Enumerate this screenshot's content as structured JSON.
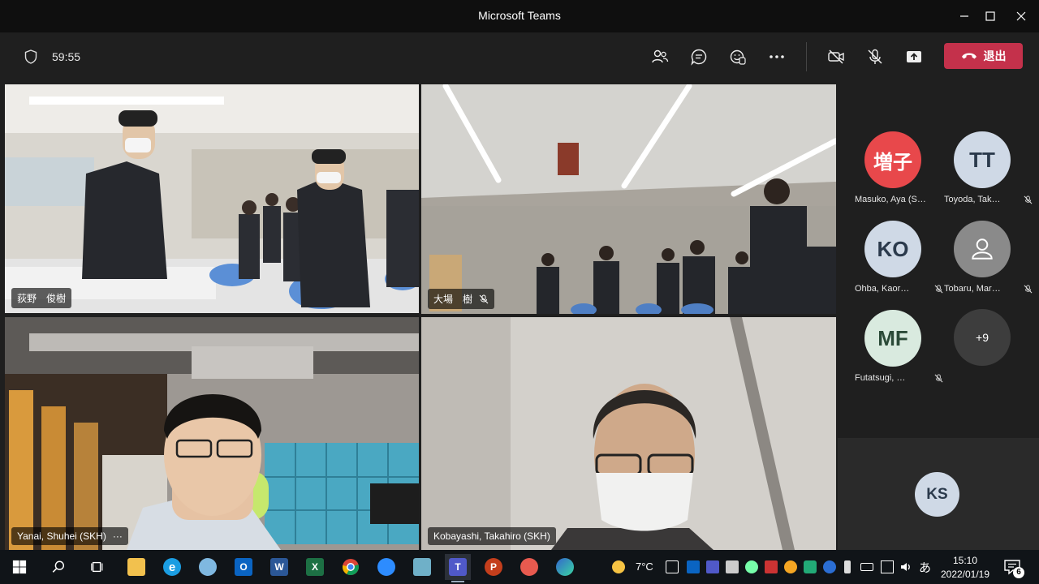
{
  "window": {
    "title": "Microsoft Teams"
  },
  "toolbar": {
    "timer": "59:55",
    "leave_label": "退出",
    "icons": [
      "people-icon",
      "chat-icon",
      "reactions-icon",
      "more-icon",
      "camera-off-icon",
      "mic-off-icon",
      "share-icon"
    ]
  },
  "video_tiles": [
    {
      "name": "荻野　俊樹",
      "active": true,
      "muted": false
    },
    {
      "name": "大場　樹",
      "active": false,
      "muted": true
    },
    {
      "name": "Yanai, Shuhei (SKH)",
      "active": false,
      "muted": false,
      "more": "···"
    },
    {
      "name": "Kobayashi, Takahiro (SKH)",
      "active": false,
      "muted": false
    }
  ],
  "roster": [
    {
      "initials": "増子",
      "name": "Masuko, Aya (S…",
      "color": "#e8484b",
      "text_color": "#ffffff",
      "muted": false
    },
    {
      "initials": "TT",
      "name": "Toyoda, Tak…",
      "color": "#cfd9e6",
      "text_color": "#2b3a4c",
      "muted": true
    },
    {
      "initials": "KO",
      "name": "Ohba, Kaor…",
      "color": "#cfd9e6",
      "text_color": "#2b3a4c",
      "muted": true
    },
    {
      "initials": "",
      "name": "Tobaru, Mar…",
      "color": "#8a8a8a",
      "text_color": "#ffffff",
      "muted": true,
      "icon": "person-icon"
    },
    {
      "initials": "MF",
      "name": "Futatsugi, …",
      "color": "#d9eadf",
      "text_color": "#2b4a38",
      "muted": true
    }
  ],
  "roster_more": "+9",
  "self_view": {
    "initials": "KS"
  },
  "taskbar": {
    "apps": [
      "windows-start",
      "search",
      "task-view",
      "file-explorer",
      "internet-explorer",
      "snipping-tool",
      "outlook",
      "word",
      "excel",
      "chrome",
      "zoom",
      "onenote",
      "teams",
      "powerpoint",
      "camera",
      "edge"
    ],
    "weather": "7°C",
    "ime": "あ",
    "time": "15:10",
    "date": "2022/01/19",
    "notifications": "6"
  }
}
